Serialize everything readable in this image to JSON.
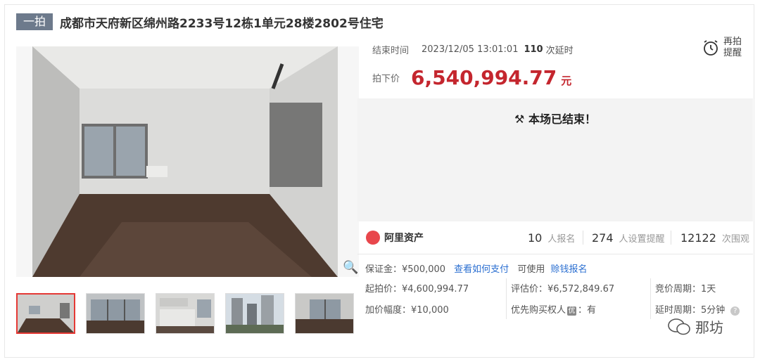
{
  "header": {
    "tag": "一拍",
    "title": "成都市天府新区绵州路2233号12栋1单元28楼2802号住宅"
  },
  "status": {
    "end_label": "结束时间",
    "end_time": "2023/12/05 13:01:01",
    "delay_count": "110",
    "delay_unit": "次延时",
    "price_label": "拍下价",
    "price": "6,540,994.77",
    "price_unit": "元",
    "remind_label": "再拍提醒",
    "ended_text": "本场已结束！"
  },
  "stats": {
    "brand": "阿里资产",
    "signups": "10",
    "signups_label": "人报名",
    "reminders": "274",
    "reminders_label": "人设置提醒",
    "views": "12122",
    "views_label": "次围观"
  },
  "details": {
    "deposit": "保证金：¥500,000",
    "how_to_pay": "查看如何支付",
    "usable": "可使用",
    "earn_signup": "赊钱报名",
    "start_price": "起拍价：¥4,600,994.77",
    "increment": "加价幅度：¥10,000",
    "appraisal": "评估价：¥6,572,849.67",
    "priority_buyer": "优先购买权人",
    "priority_badge": "优",
    "priority_value": "：有",
    "bid_period": "竞价周期：1天",
    "delay_period": "延时周期：5分钟",
    "help": "?"
  },
  "watermark": "那坊",
  "colors": {
    "accent": "#c4262e",
    "tag_bg": "#6d7a8c",
    "link": "#2b6fd1",
    "selected_border": "#e53935"
  }
}
